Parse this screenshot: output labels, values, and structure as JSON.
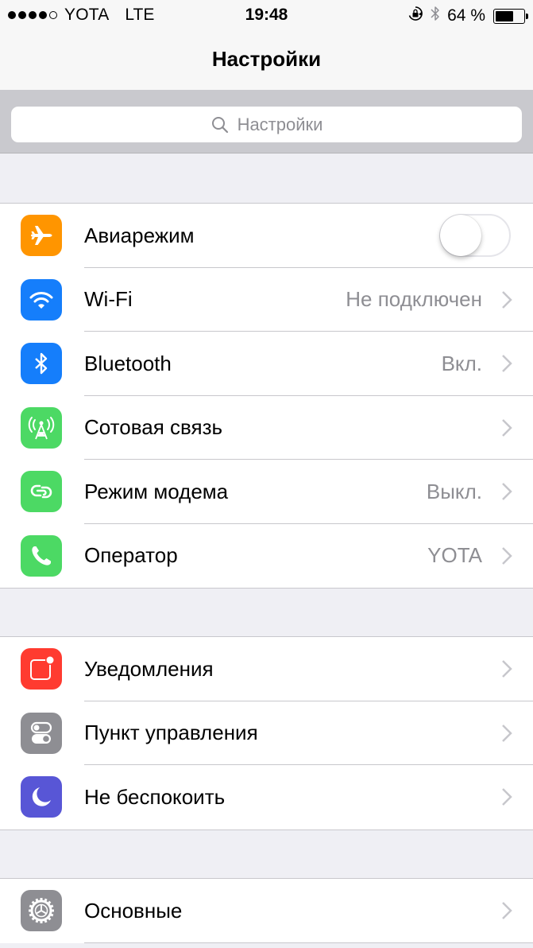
{
  "status_bar": {
    "signal_bars_filled": 4,
    "signal_bars_total": 5,
    "carrier": "YOTA",
    "network": "LTE",
    "time": "19:48",
    "orientation_lock_icon": "orientation-lock-icon",
    "bluetooth_icon": "bluetooth-icon",
    "battery_percent_text": "64 %",
    "battery_level": 0.64
  },
  "nav": {
    "title": "Настройки"
  },
  "search": {
    "placeholder": "Настройки",
    "icon": "search-icon"
  },
  "colors": {
    "orange": "#ff9500",
    "blue": "#157efb",
    "green": "#4cd964",
    "red": "#ff3b30",
    "gray": "#8e8e93",
    "purple": "#5856d6",
    "chevron": "#c7c7cc",
    "value_text": "#8e8e93"
  },
  "groups": [
    {
      "rows": [
        {
          "label": "Авиарежим",
          "icon": "airplane-icon",
          "icon_color": "#ff9500",
          "control": "toggle",
          "toggle_on": false
        },
        {
          "label": "Wi-Fi",
          "icon": "wifi-icon",
          "icon_color": "#157efb",
          "value": "Не подключен",
          "control": "chevron"
        },
        {
          "label": "Bluetooth",
          "icon": "bluetooth-icon",
          "icon_color": "#157efb",
          "value": "Вкл.",
          "control": "chevron"
        },
        {
          "label": "Сотовая связь",
          "icon": "cellular-antenna-icon",
          "icon_color": "#4cd964",
          "value": "",
          "control": "chevron"
        },
        {
          "label": "Режим модема",
          "icon": "personal-hotspot-icon",
          "icon_color": "#4cd964",
          "value": "Выкл.",
          "control": "chevron"
        },
        {
          "label": "Оператор",
          "icon": "phone-icon",
          "icon_color": "#4cd964",
          "value": "YOTA",
          "control": "chevron"
        }
      ]
    },
    {
      "rows": [
        {
          "label": "Уведомления",
          "icon": "notifications-icon",
          "icon_color": "#ff3b30",
          "control": "chevron"
        },
        {
          "label": "Пункт управления",
          "icon": "control-center-icon",
          "icon_color": "#8e8e93",
          "control": "chevron"
        },
        {
          "label": "Не беспокоить",
          "icon": "moon-icon",
          "icon_color": "#5856d6",
          "control": "chevron"
        }
      ]
    },
    {
      "rows": [
        {
          "label": "Основные",
          "icon": "gear-icon",
          "icon_color": "#8e8e93",
          "control": "chevron"
        }
      ]
    }
  ]
}
